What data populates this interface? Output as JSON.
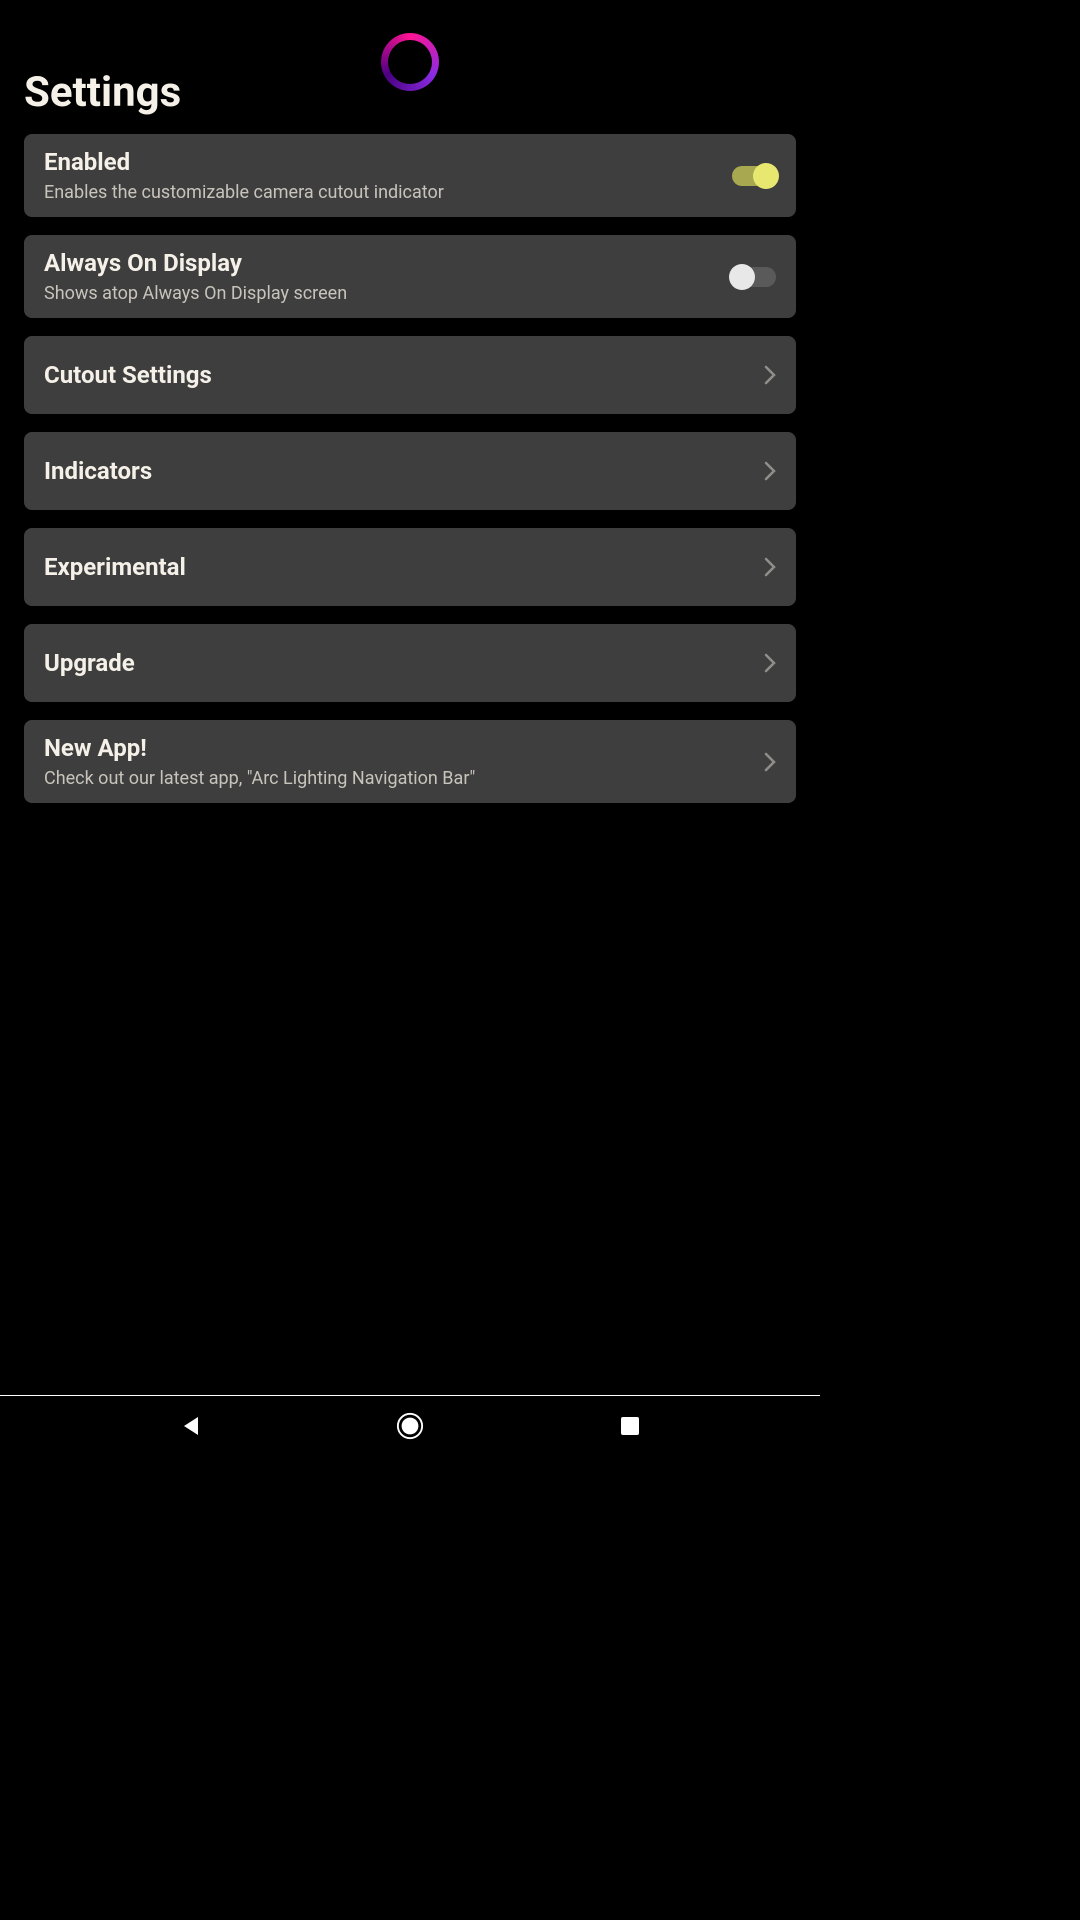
{
  "page": {
    "title": "Settings"
  },
  "settings": [
    {
      "title": "Enabled",
      "desc": "Enables the customizable camera cutout indicator",
      "type": "toggle",
      "value": true
    },
    {
      "title": "Always On Display",
      "desc": "Shows atop Always On Display screen",
      "type": "toggle",
      "value": false
    },
    {
      "title": "Cutout Settings",
      "desc": null,
      "type": "nav"
    },
    {
      "title": "Indicators",
      "desc": null,
      "type": "nav"
    },
    {
      "title": "Experimental",
      "desc": null,
      "type": "nav"
    },
    {
      "title": "Upgrade",
      "desc": null,
      "type": "nav"
    },
    {
      "title": "New App!",
      "desc": "Check out our latest app, \"Arc Lighting Navigation Bar\"",
      "type": "nav"
    }
  ]
}
